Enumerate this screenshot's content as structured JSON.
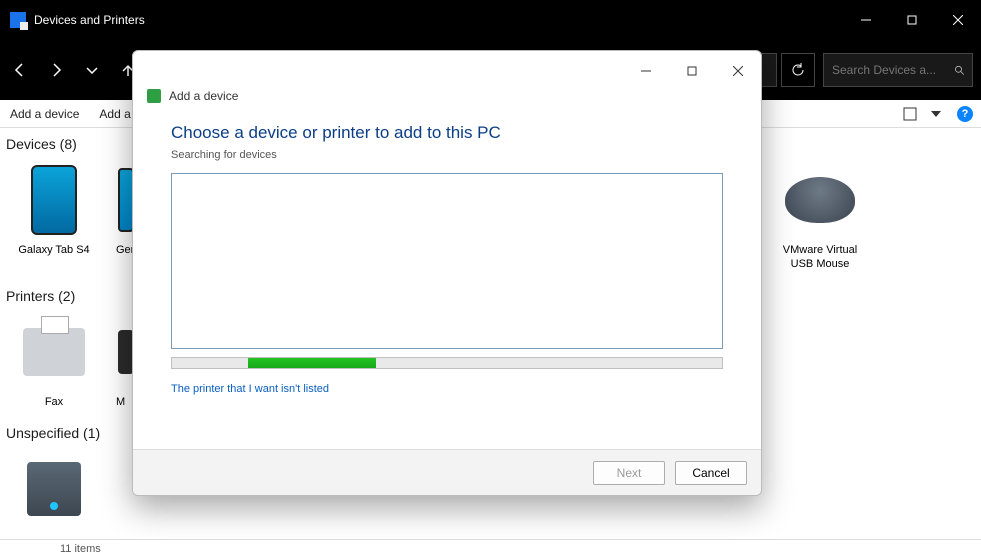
{
  "window": {
    "title": "Devices and Printers"
  },
  "search": {
    "placeholder": "Search Devices a..."
  },
  "commandbar": {
    "add_device": "Add a device",
    "add_printer_partial": "Add a"
  },
  "groups": {
    "devices": {
      "header": "Devices (8)"
    },
    "printers": {
      "header": "Printers (2)"
    },
    "unspecified": {
      "header": "Unspecified (1)"
    }
  },
  "devices": [
    {
      "label": "Galaxy Tab S4"
    },
    {
      "label": "Ger"
    },
    {
      "label": "VMware Virtual USB Mouse"
    }
  ],
  "printers": [
    {
      "label": "Fax"
    },
    {
      "label": "M"
    }
  ],
  "statusbar": {
    "count": "11 items"
  },
  "dialog": {
    "header": "Add a device",
    "title": "Choose a device or printer to add to this PC",
    "subtitle": "Searching for devices",
    "link": "The printer that I want isn't listed",
    "next": "Next",
    "cancel": "Cancel"
  }
}
